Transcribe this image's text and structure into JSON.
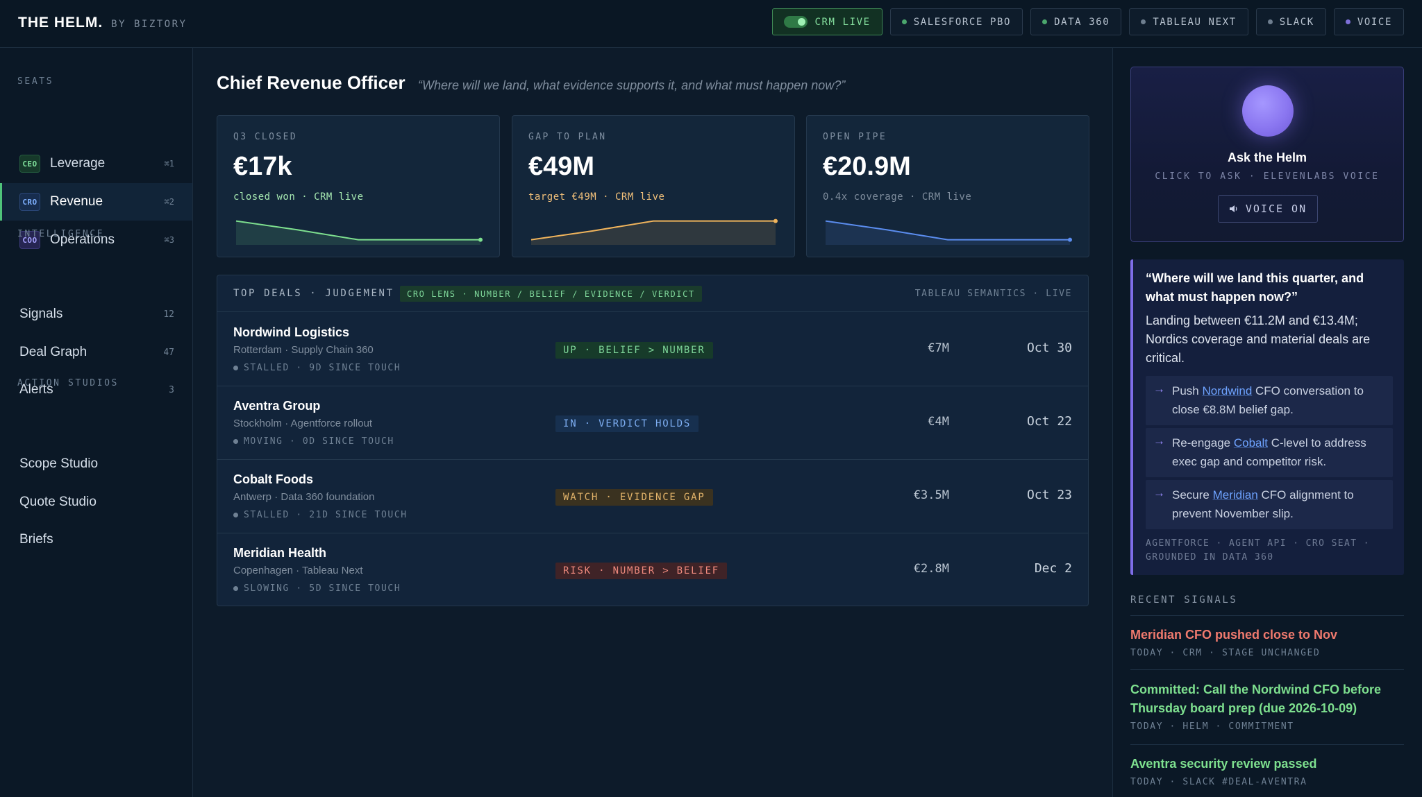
{
  "brand": {
    "name": "THE HELM.",
    "sub": "BY BIZTORY"
  },
  "integrations": [
    {
      "label": "CRM LIVE"
    },
    {
      "label": "SALESFORCE PBO"
    },
    {
      "label": "DATA 360"
    },
    {
      "label": "TABLEAU NEXT"
    },
    {
      "label": "SLACK"
    },
    {
      "label": "VOICE"
    }
  ],
  "sidebar": {
    "seats_label": "SEATS",
    "seats": [
      {
        "badge": "CEO",
        "label": "Leverage",
        "shortcut": "⌘1"
      },
      {
        "badge": "CRO",
        "label": "Revenue",
        "shortcut": "⌘2"
      },
      {
        "badge": "COO",
        "label": "Operations",
        "shortcut": "⌘3"
      }
    ],
    "intelligence_label": "INTELLIGENCE",
    "intelligence": [
      {
        "label": "Signals",
        "count": "12"
      },
      {
        "label": "Deal Graph",
        "count": "47"
      },
      {
        "label": "Alerts",
        "count": "3"
      }
    ],
    "studios_label": "ACTION STUDIOS",
    "studios": [
      {
        "label": "Scope Studio"
      },
      {
        "label": "Quote Studio"
      },
      {
        "label": "Briefs"
      }
    ]
  },
  "page": {
    "title": "Chief Revenue Officer",
    "quote": "“Where will we land, what evidence supports it, and what must happen now?”"
  },
  "kpis": [
    {
      "label": "Q3 CLOSED",
      "value": "€17k",
      "sub": "closed won · CRM live",
      "color": "#7ee08f",
      "trend": [
        0.9,
        0.55,
        0.15,
        0.15,
        0.15
      ]
    },
    {
      "label": "GAP TO PLAN",
      "value": "€49M",
      "sub": "target €49M · CRM live",
      "color": "#f0b45c",
      "trend": [
        0.15,
        0.5,
        0.9,
        0.9,
        0.9
      ]
    },
    {
      "label": "OPEN PIPE",
      "value": "€20.9M",
      "sub": "0.4x coverage · CRM live",
      "color": "#5b8def",
      "trend": [
        0.9,
        0.55,
        0.15,
        0.15,
        0.15
      ]
    }
  ],
  "deals": {
    "title": "TOP DEALS · JUDGEMENT",
    "lens": "CRO LENS · NUMBER / BELIEF / EVIDENCE / VERDICT",
    "right_label": "TABLEAU SEMANTICS · LIVE",
    "rows": [
      {
        "name": "Nordwind Logistics",
        "meta": "Rotterdam · Supply Chain 360",
        "status": "STALLED · 9D SINCE TOUCH",
        "judgement": "UP · BELIEF > NUMBER",
        "kind": "up",
        "amount": "€7M",
        "date": "Oct 30"
      },
      {
        "name": "Aventra Group",
        "meta": "Stockholm · Agentforce rollout",
        "status": "MOVING · 0D SINCE TOUCH",
        "judgement": "IN · VERDICT HOLDS",
        "kind": "in",
        "amount": "€4M",
        "date": "Oct 22"
      },
      {
        "name": "Cobalt Foods",
        "meta": "Antwerp · Data 360 foundation",
        "status": "STALLED · 21D SINCE TOUCH",
        "judgement": "WATCH · EVIDENCE GAP",
        "kind": "watch",
        "amount": "€3.5M",
        "date": "Oct 23"
      },
      {
        "name": "Meridian Health",
        "meta": "Copenhagen · Tableau Next",
        "status": "SLOWING · 5D SINCE TOUCH",
        "judgement": "RISK · NUMBER > BELIEF",
        "kind": "risk",
        "amount": "€2.8M",
        "date": "Dec 2"
      }
    ]
  },
  "ask": {
    "title": "Ask the Helm",
    "sub": "CLICK TO ASK · ELEVENLABS VOICE",
    "voice_button": "VOICE ON"
  },
  "answer": {
    "question": "“Where will we land this quarter, and what must happen now?”",
    "body": "Landing between €11.2M and €13.4M; Nordics coverage and material deals are critical.",
    "actions": [
      {
        "pre": "Push ",
        "link": "Nordwind",
        "post": " CFO conversation to close €8.8M belief gap."
      },
      {
        "pre": "Re-engage ",
        "link": "Cobalt",
        "post": " C-level to address exec gap and competitor risk."
      },
      {
        "pre": "Secure ",
        "link": "Meridian",
        "post": " CFO alignment to prevent November slip."
      }
    ],
    "footer": "AGENTFORCE · AGENT API · CRO SEAT · GROUNDED IN DATA 360"
  },
  "recent": {
    "label": "RECENT SIGNALS",
    "items": [
      {
        "title": "Meridian CFO pushed close to Nov",
        "meta": "TODAY · CRM · STAGE UNCHANGED",
        "color": "#f07a6e"
      },
      {
        "title": "Committed: Call the Nordwind CFO before Thursday board prep (due 2026-10-09)",
        "meta": "TODAY · HELM · COMMITMENT",
        "color": "#7ee08f"
      },
      {
        "title": "Aventra security review passed",
        "meta": "TODAY · SLACK #DEAL-AVENTRA",
        "color": "#7ee08f"
      }
    ]
  }
}
